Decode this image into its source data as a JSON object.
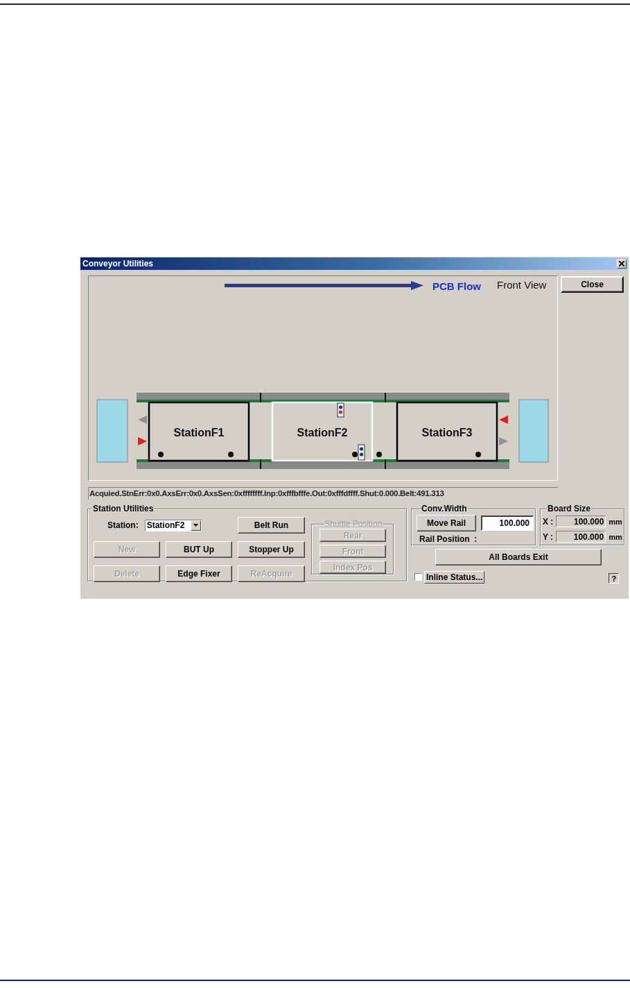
{
  "window": {
    "title": "Conveyor Utilities"
  },
  "diagram": {
    "flow_label": "PCB Flow",
    "view_label": "Front View",
    "stations": [
      {
        "name": "StationF1",
        "selected": false
      },
      {
        "name": "StationF2",
        "selected": true
      },
      {
        "name": "StationF3",
        "selected": false
      }
    ],
    "signals": [
      {
        "on": false
      },
      {
        "on": true
      },
      {
        "on": true
      },
      {
        "on": false
      }
    ]
  },
  "close_button": "Close",
  "status_text": "Acquied.StnErr:0x0.AxsErr:0x0.AxsSen:0xffffffff.Inp:0xfffbfffe.Out:0xfffdffff.Shut:0.000.Belt:491.313",
  "station_utilities": {
    "title": "Station Utilities",
    "station_label": "Station:",
    "station_value": "StationF2",
    "buttons": [
      {
        "label": "Belt Run",
        "disabled": false
      },
      {
        "label": "New",
        "disabled": true
      },
      {
        "label": "BUT Up",
        "disabled": false
      },
      {
        "label": "Stopper Up",
        "disabled": false
      },
      {
        "label": "Delete",
        "disabled": true
      },
      {
        "label": "Edge Fixer",
        "disabled": false
      },
      {
        "label": "ReAcquire",
        "disabled": true
      }
    ]
  },
  "shuttle_position": {
    "title": "Shuttle Position",
    "disabled": true,
    "buttons": [
      {
        "label": "Rear",
        "disabled": true
      },
      {
        "label": "Front",
        "disabled": true
      },
      {
        "label": "Index Pos",
        "disabled": true
      }
    ]
  },
  "conv_width": {
    "title": "Conv.Width",
    "button": "Move Rail",
    "value": "100.000",
    "rail_position_label": "Rail Position  :"
  },
  "board_size": {
    "title": "Board Size",
    "rows": [
      {
        "axis": "X :",
        "value": "100.000",
        "unit": "mm"
      },
      {
        "axis": "Y :",
        "value": "100.000",
        "unit": "mm"
      }
    ]
  },
  "all_boards_exit": "All Boards Exit",
  "inline_status": {
    "label": "Inline Status...",
    "checked": false
  },
  "help": "?"
}
